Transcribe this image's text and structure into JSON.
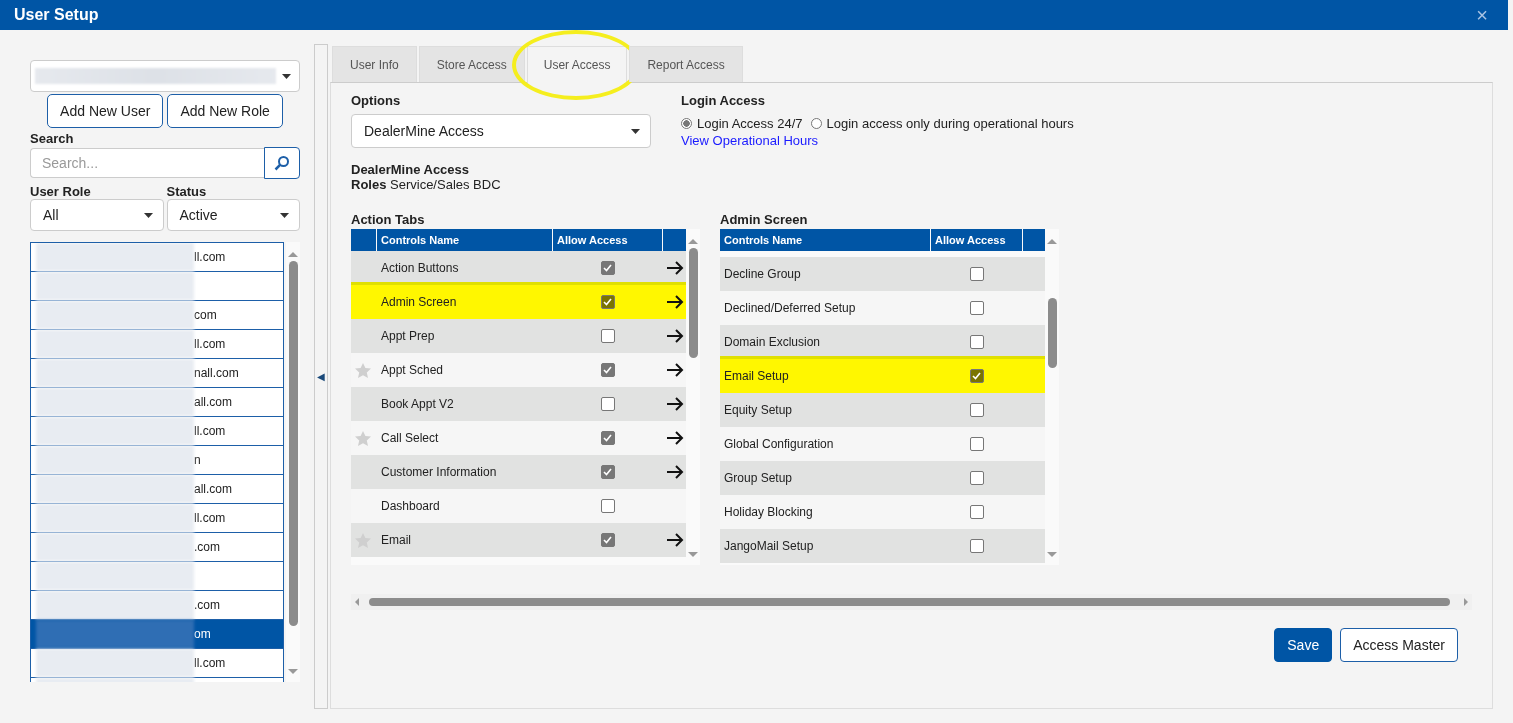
{
  "window": {
    "title": "User Setup",
    "close": "×"
  },
  "left": {
    "buttons": [
      "Add New User",
      "Add New Role"
    ],
    "search_label": "Search",
    "search": {
      "placeholder": "Search..."
    },
    "role_label": "User Role",
    "role_value": "All",
    "status_label": "Status",
    "status_value": "Active",
    "users": [
      {
        "suffix": "ll.com",
        "selected": false
      },
      {
        "selected": false
      },
      {
        "suffix": "com",
        "selected": false
      },
      {
        "suffix": "ll.com",
        "selected": false
      },
      {
        "suffix": "nall.com",
        "selected": false
      },
      {
        "suffix": "all.com",
        "selected": false
      },
      {
        "suffix": "ll.com",
        "selected": false
      },
      {
        "suffix": "n",
        "selected": false
      },
      {
        "suffix": "all.com",
        "selected": false
      },
      {
        "suffix": "ll.com",
        "selected": false
      },
      {
        "suffix": ".com",
        "selected": false
      },
      {
        "selected": false
      },
      {
        "suffix": ".com",
        "selected": false
      },
      {
        "suffix": "om",
        "selected": true
      },
      {
        "suffix": "ll.com",
        "selected": false
      },
      {
        "selected": false
      }
    ]
  },
  "collapse": "◀",
  "tabs": [
    {
      "label": "User Info",
      "selected": false,
      "circled": false
    },
    {
      "label": "Store Access",
      "selected": false,
      "circled": false
    },
    {
      "label": "User Access",
      "selected": true,
      "circled": true
    },
    {
      "label": "Report Access",
      "selected": false,
      "circled": false
    }
  ],
  "options": {
    "label": "Options",
    "value": "DealerMine Access"
  },
  "login": {
    "label": "Login Access",
    "choices": [
      {
        "label": "Login Access 24/7",
        "selected": true
      },
      {
        "label": "Login access only during operational hours",
        "selected": false
      }
    ],
    "link": "View Operational Hours"
  },
  "summary": {
    "title": "DealerMine Access",
    "roles": "**Roles** Service/Sales BDC"
  },
  "action_tabs": {
    "title": "Action Tabs",
    "columns": [
      "Controls Name",
      "Allow Access"
    ],
    "rows": [
      {
        "name": "Action Buttons",
        "starred": false,
        "checked": true,
        "highlighted": false,
        "arrow": true
      },
      {
        "name": "Admin Screen",
        "starred": false,
        "checked": true,
        "highlighted": true,
        "arrow": true
      },
      {
        "name": "Appt Prep",
        "starred": false,
        "checked": false,
        "highlighted": false,
        "arrow": true
      },
      {
        "name": "Appt Sched",
        "starred": true,
        "checked": true,
        "highlighted": false,
        "arrow": true
      },
      {
        "name": "Book Appt V2",
        "starred": false,
        "checked": false,
        "highlighted": false,
        "arrow": true
      },
      {
        "name": "Call Select",
        "starred": true,
        "checked": true,
        "highlighted": false,
        "arrow": true
      },
      {
        "name": "Customer Information",
        "starred": false,
        "checked": true,
        "highlighted": false,
        "arrow": true
      },
      {
        "name": "Dashboard",
        "starred": false,
        "checked": false,
        "highlighted": false,
        "arrow": false
      },
      {
        "name": "Email",
        "starred": true,
        "checked": true,
        "highlighted": false,
        "arrow": true
      }
    ]
  },
  "admin_screen": {
    "title": "Admin Screen",
    "columns": [
      "Controls Name",
      "Allow Access"
    ],
    "rows": [
      {
        "name": "Decline Group",
        "checked": false,
        "highlighted": false
      },
      {
        "name": "Declined/Deferred Setup",
        "checked": false,
        "highlighted": false
      },
      {
        "name": "Domain Exclusion",
        "checked": false,
        "highlighted": false
      },
      {
        "name": "Email Setup",
        "checked": true,
        "highlighted": true
      },
      {
        "name": "Equity Setup",
        "checked": false,
        "highlighted": false
      },
      {
        "name": "Global Configuration",
        "checked": false,
        "highlighted": false
      },
      {
        "name": "Group Setup",
        "checked": false,
        "highlighted": false
      },
      {
        "name": "Holiday Blocking",
        "checked": false,
        "highlighted": false
      },
      {
        "name": "JangoMail Setup",
        "checked": false,
        "highlighted": false
      }
    ]
  },
  "buttons": [
    {
      "label": "Save",
      "kind": "primary"
    },
    {
      "label": "Access Master",
      "kind": "secondary"
    }
  ]
}
